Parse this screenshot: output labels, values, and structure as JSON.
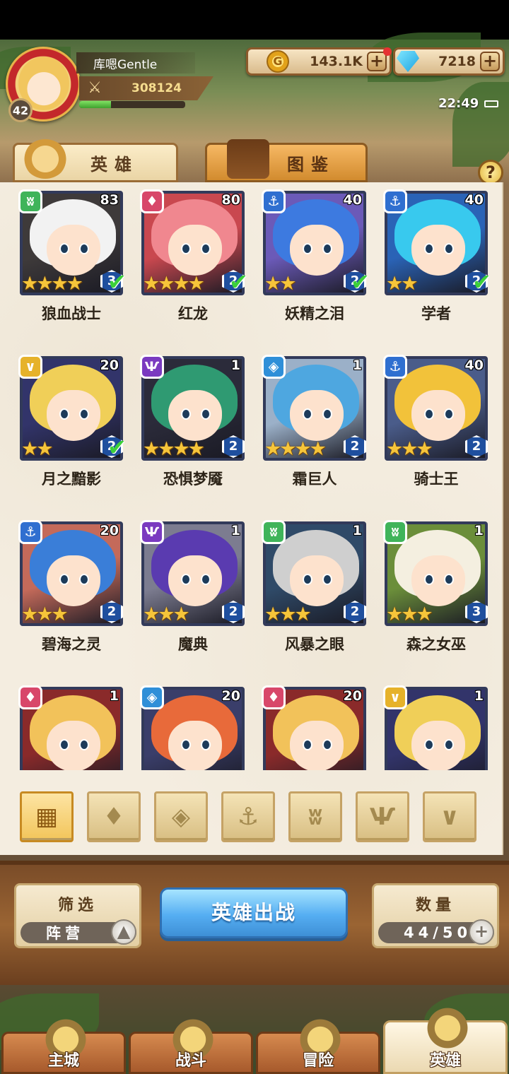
{
  "player": {
    "name": "库嗯Gentle",
    "level": "42",
    "power": "308124",
    "exp_fraction": 0.3
  },
  "currency": {
    "gold": "143.1K",
    "gems": "7218",
    "plus": "+"
  },
  "status": {
    "time": "22:49"
  },
  "tabs": {
    "heroes": "英雄",
    "compendium": "图鉴",
    "help": "?"
  },
  "heroes": [
    {
      "name": "狼血战士",
      "level": "83",
      "stars": "★★★★",
      "rank": "3",
      "checked": true,
      "faction": "beast",
      "colors": [
        "#3e3a3a",
        "#f2f2f2"
      ]
    },
    {
      "name": "红龙",
      "level": "80",
      "stars": "★★★★",
      "rank": "2",
      "checked": true,
      "faction": "fire",
      "colors": [
        "#c9484f",
        "#f0878f"
      ]
    },
    {
      "name": "妖精之泪",
      "level": "40",
      "stars": "★★",
      "rank": "2",
      "checked": true,
      "faction": "water",
      "colors": [
        "#6b5ab8",
        "#3d7ae0"
      ]
    },
    {
      "name": "学者",
      "level": "40",
      "stars": "★★",
      "rank": "2",
      "checked": true,
      "faction": "water",
      "colors": [
        "#2a63b6",
        "#38c9ee"
      ]
    },
    {
      "name": "月之黯影",
      "level": "20",
      "stars": "★★",
      "rank": "2",
      "checked": true,
      "faction": "light",
      "colors": [
        "#32346a",
        "#f0cf58"
      ]
    },
    {
      "name": "恐惧梦魇",
      "level": "1",
      "stars": "★★★★",
      "rank": "2",
      "checked": false,
      "faction": "dark",
      "colors": [
        "#2b2b3a",
        "#2f9a72"
      ]
    },
    {
      "name": "霜巨人",
      "level": "1",
      "stars": "★★★★",
      "rank": "2",
      "checked": false,
      "faction": "ice",
      "colors": [
        "#9bb0c8",
        "#4ea7e0"
      ]
    },
    {
      "name": "骑士王",
      "level": "40",
      "stars": "★★★",
      "rank": "2",
      "checked": false,
      "faction": "water",
      "colors": [
        "#4a5c8a",
        "#f2c23a"
      ]
    },
    {
      "name": "碧海之灵",
      "level": "20",
      "stars": "★★★",
      "rank": "2",
      "checked": false,
      "faction": "water",
      "colors": [
        "#c46a5a",
        "#3a7ed8"
      ]
    },
    {
      "name": "魔典",
      "level": "1",
      "stars": "★★★",
      "rank": "2",
      "checked": false,
      "faction": "dark",
      "colors": [
        "#7c7c90",
        "#5a3bb0"
      ]
    },
    {
      "name": "风暴之眼",
      "level": "1",
      "stars": "★★★",
      "rank": "2",
      "checked": false,
      "faction": "beast",
      "colors": [
        "#2f4a68",
        "#cfcfcf"
      ]
    },
    {
      "name": "森之女巫",
      "level": "1",
      "stars": "★★★",
      "rank": "3",
      "checked": false,
      "faction": "beast",
      "colors": [
        "#6b8e3a",
        "#f4efe0"
      ]
    },
    {
      "name": "",
      "level": "1",
      "stars": "",
      "rank": "",
      "checked": false,
      "faction": "fire",
      "colors": [
        "#8a2a2a",
        "#f2c25a"
      ]
    },
    {
      "name": "",
      "level": "20",
      "stars": "",
      "rank": "",
      "checked": false,
      "faction": "ice",
      "colors": [
        "#3a3e6a",
        "#e86a3a"
      ]
    },
    {
      "name": "",
      "level": "20",
      "stars": "",
      "rank": "",
      "checked": false,
      "faction": "fire",
      "colors": [
        "#8a2a2a",
        "#f2c25a"
      ]
    },
    {
      "name": "",
      "level": "1",
      "stars": "",
      "rank": "",
      "checked": false,
      "faction": "light",
      "colors": [
        "#32346a",
        "#f0cf58"
      ]
    }
  ],
  "faction_styles": {
    "beast": {
      "color": "#3fb45a",
      "glyph": "ʬ"
    },
    "fire": {
      "color": "#d8476a",
      "glyph": "♦"
    },
    "water": {
      "color": "#2f6fd0",
      "glyph": "⚓"
    },
    "light": {
      "color": "#e6b22a",
      "glyph": "∨"
    },
    "dark": {
      "color": "#7a3ac0",
      "glyph": "Ѱ"
    },
    "ice": {
      "color": "#2f8fd8",
      "glyph": "◈"
    }
  },
  "filters": [
    {
      "id": "all",
      "glyph": "▦"
    },
    {
      "id": "fire",
      "glyph": "♦"
    },
    {
      "id": "ice",
      "glyph": "◈"
    },
    {
      "id": "water",
      "glyph": "⚓"
    },
    {
      "id": "beast",
      "glyph": "ʬ"
    },
    {
      "id": "dark",
      "glyph": "Ѱ"
    },
    {
      "id": "light",
      "glyph": "∨"
    }
  ],
  "bottom": {
    "filter_title": "筛选",
    "filter_value": "阵营",
    "filter_btn": "▲",
    "deploy": "英雄出战",
    "count_title": "数量",
    "count_value": "44/50",
    "count_btn": "+"
  },
  "nav": [
    {
      "label": "主城"
    },
    {
      "label": "战斗"
    },
    {
      "label": "冒险"
    },
    {
      "label": "英雄"
    }
  ]
}
